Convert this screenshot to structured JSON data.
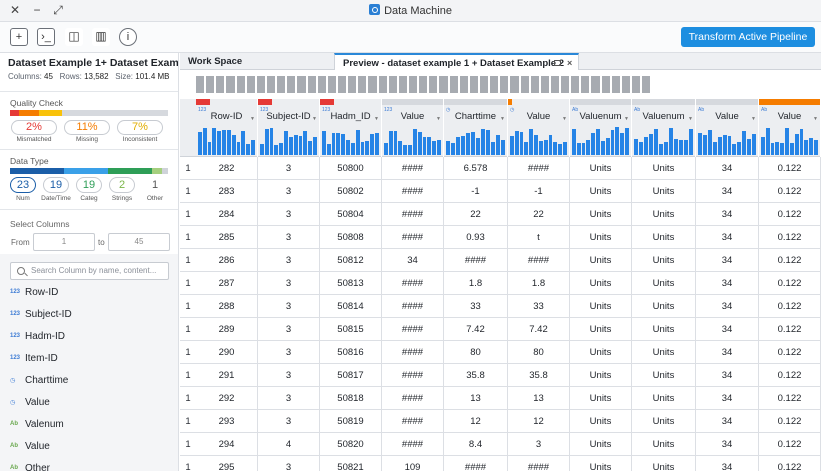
{
  "window": {
    "title": "Data Machine"
  },
  "toolbar": {
    "primary_label": "Transform Active Pipeline"
  },
  "dataset": {
    "title": "Dataset Example 1+ Dataset Example 2",
    "columns_label": "Columns:",
    "columns_value": "45",
    "rows_label": "Rows:",
    "rows_value": "13,582",
    "size_label": "Size:",
    "size_value": "101.4 MB"
  },
  "quality": {
    "label": "Quality Check",
    "mismatched": {
      "value": "2%",
      "caption": "Mismatched",
      "color": "#e53935"
    },
    "missing": {
      "value": "11%",
      "caption": "Missing",
      "color": "#f57c00"
    },
    "inconsistent": {
      "value": "7%",
      "caption": "Inconsistent",
      "color": "#f9c20a"
    }
  },
  "data_type": {
    "label": "Data Type",
    "items": [
      {
        "value": "23",
        "caption": "Num",
        "color": "#1b5ea8"
      },
      {
        "value": "19",
        "caption": "Date/Time",
        "color": "#3aa0e8"
      },
      {
        "value": "19",
        "caption": "Categ",
        "color": "#2e9e57"
      },
      {
        "value": "2",
        "caption": "Strings",
        "color": "#7ab648"
      },
      {
        "value": "1",
        "caption": "Other",
        "color": "#555555"
      }
    ]
  },
  "select_columns": {
    "label": "Select Columns",
    "from_label": "From",
    "from_value": "1",
    "to_label": "to",
    "to_value": "45"
  },
  "search": {
    "placeholder": "Search Column by name, content..."
  },
  "column_list": [
    {
      "type": "123",
      "name": "Row-ID"
    },
    {
      "type": "123",
      "name": "Subject-ID"
    },
    {
      "type": "123",
      "name": "Hadm-ID"
    },
    {
      "type": "123",
      "name": "Item-ID"
    },
    {
      "type": "◷",
      "name": "Charttime"
    },
    {
      "type": "◷",
      "name": "Value"
    },
    {
      "type": "Ab",
      "name": "Valenum"
    },
    {
      "type": "Ab",
      "name": "Value"
    },
    {
      "type": "Ab",
      "name": "Other"
    }
  ],
  "tabs": {
    "workspace": "Work Space",
    "preview": "Preview - dataset example 1 + Dataset Example 2",
    "close": "×"
  },
  "grid": {
    "columns": [
      "Row-ID",
      "Subject-ID",
      "Hadm_ID",
      "Value",
      "Charttime",
      "Value",
      "Valuenum",
      "Valuenum",
      "Value",
      "Value"
    ],
    "rows": [
      [
        "1",
        "282",
        "3",
        "50800",
        "####",
        "6.578",
        "####",
        "Units",
        "Units",
        "34",
        "0.122"
      ],
      [
        "1",
        "283",
        "3",
        "50802",
        "####",
        "-1",
        "-1",
        "Units",
        "Units",
        "34",
        "0.122"
      ],
      [
        "1",
        "284",
        "3",
        "50804",
        "####",
        "22",
        "22",
        "Units",
        "Units",
        "34",
        "0.122"
      ],
      [
        "1",
        "285",
        "3",
        "50808",
        "####",
        "0.93",
        "t",
        "Units",
        "Units",
        "34",
        "0.122"
      ],
      [
        "1",
        "286",
        "3",
        "50812",
        "34",
        "####",
        "####",
        "Units",
        "Units",
        "34",
        "0.122"
      ],
      [
        "1",
        "287",
        "3",
        "50813",
        "####",
        "1.8",
        "1.8",
        "Units",
        "Units",
        "34",
        "0.122"
      ],
      [
        "1",
        "288",
        "3",
        "50814",
        "####",
        "33",
        "33",
        "Units",
        "Units",
        "34",
        "0.122"
      ],
      [
        "1",
        "289",
        "3",
        "50815",
        "####",
        "7.42",
        "7.42",
        "Units",
        "Units",
        "34",
        "0.122"
      ],
      [
        "1",
        "290",
        "3",
        "50816",
        "####",
        "80",
        "80",
        "Units",
        "Units",
        "34",
        "0.122"
      ],
      [
        "1",
        "291",
        "3",
        "50817",
        "####",
        "35.8",
        "35.8",
        "Units",
        "Units",
        "34",
        "0.122"
      ],
      [
        "1",
        "292",
        "3",
        "50818",
        "####",
        "13",
        "13",
        "Units",
        "Units",
        "34",
        "0.122"
      ],
      [
        "1",
        "293",
        "3",
        "50819",
        "####",
        "12",
        "12",
        "Units",
        "Units",
        "34",
        "0.122"
      ],
      [
        "1",
        "294",
        "4",
        "50820",
        "####",
        "8.4",
        "3",
        "Units",
        "Units",
        "34",
        "0.122"
      ],
      [
        "1",
        "295",
        "3",
        "50821",
        "109",
        "####",
        "####",
        "Units",
        "Units",
        "34",
        "0.122"
      ]
    ]
  }
}
